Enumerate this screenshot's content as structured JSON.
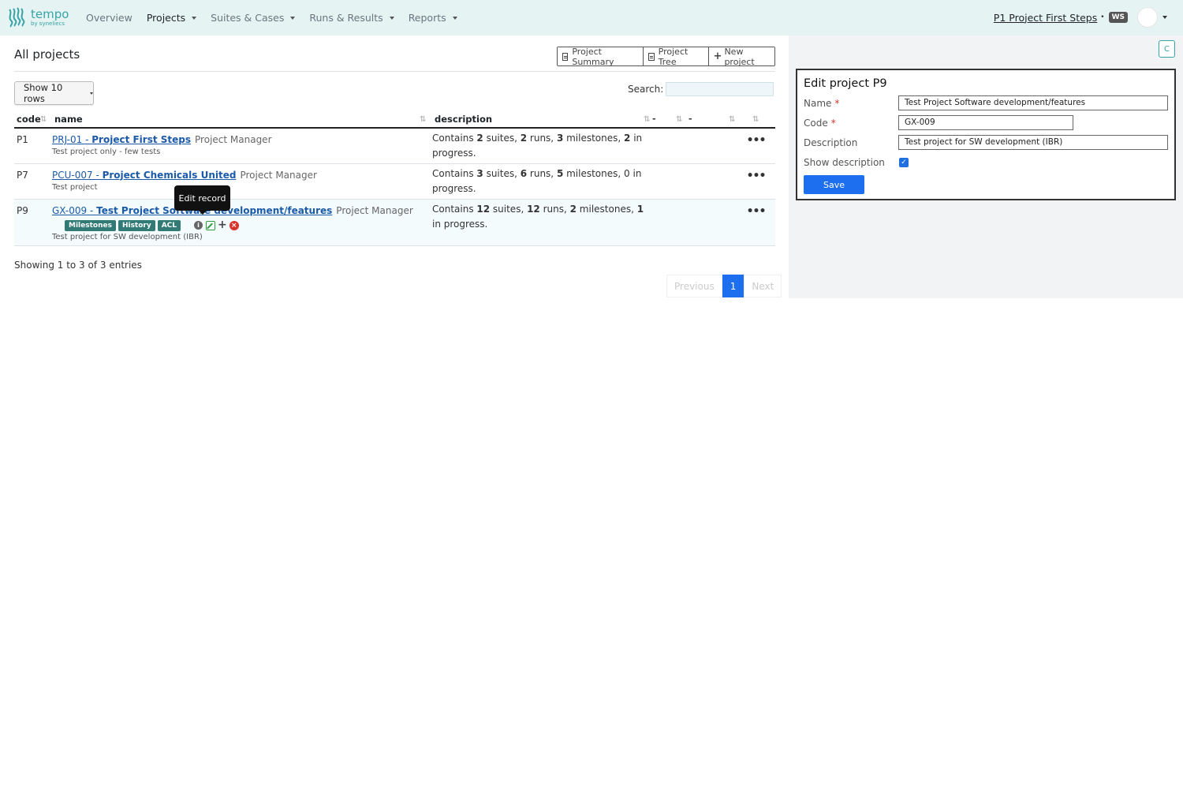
{
  "app": {
    "logo_word": "tempo",
    "logo_sub": "by syneliecs"
  },
  "nav": {
    "items": [
      {
        "label": "Overview",
        "has_caret": false
      },
      {
        "label": "Projects",
        "has_caret": true
      },
      {
        "label": "Suites & Cases",
        "has_caret": true
      },
      {
        "label": "Runs & Results",
        "has_caret": true
      },
      {
        "label": "Reports",
        "has_caret": true
      }
    ],
    "current_project": "P1 Project First Steps",
    "workspace_badge": "WS"
  },
  "page": {
    "title": "All projects",
    "buttons": {
      "project_summary": "Project Summary",
      "project_tree": "Project Tree",
      "new_project": "New project"
    },
    "rows_selector": "Show 10 rows",
    "search_label": "Search:",
    "search_value": ""
  },
  "table": {
    "headers": {
      "code": "code",
      "name": "name",
      "description": "description",
      "dash1": "-",
      "dash2": "-"
    },
    "rows": [
      {
        "code": "P1",
        "name_code": "PRJ-01 - ",
        "name_title": "Project First Steps",
        "role": "Project Manager",
        "subdesc": "Test project only - few tests",
        "d1": "Contains ",
        "n_suites": "2",
        "d2": " suites, ",
        "n_runs": "2",
        "d3": " runs, ",
        "n_milestones": "3",
        "d4": " milestones, ",
        "n_inprogress": "2",
        "d5": " in progress."
      },
      {
        "code": "P7",
        "name_code": "PCU-007 - ",
        "name_title": "Project Chemicals United",
        "role": "Project Manager",
        "subdesc": "Test project",
        "d1": "Contains ",
        "n_suites": "3",
        "d2": " suites, ",
        "n_runs": "6",
        "d3": " runs, ",
        "n_milestones": "5",
        "d4": " milestones, ",
        "n_inprogress": "0",
        "d5": " in progress."
      },
      {
        "code": "P9",
        "name_code": "GX-009 - ",
        "name_title": "Test Project Software development/features",
        "role": "Project Manager",
        "subdesc": "Test project for SW development (IBR)",
        "d1": "Contains ",
        "n_suites": "12",
        "d2": " suites, ",
        "n_runs": "12",
        "d3": " runs, ",
        "n_milestones": "2",
        "d4": " milestones, ",
        "n_inprogress": "1",
        "d5": " in progress.",
        "tags": [
          "Milestones",
          "History",
          "ACL"
        ]
      }
    ],
    "row_menu": "•••"
  },
  "tooltip": "Edit record",
  "footer": {
    "showing": "Showing 1 to 3 of 3 entries",
    "prev": "Previous",
    "page": "1",
    "next": "Next"
  },
  "sidebar": {
    "c_button": "C",
    "edit": {
      "title": "Edit project P9",
      "name_label": "Name",
      "name_value": "Test Project Software development/features",
      "code_label": "Code",
      "code_value": "GX-009",
      "desc_label": "Description",
      "desc_value": "Test project for SW development (IBR)",
      "show_desc_label": "Show description",
      "show_desc_checked": true,
      "save": "Save"
    }
  },
  "colors": {
    "topbar": "#e5f3f3",
    "brand": "#36a3a6",
    "link": "#1a5aa8",
    "primary": "#1e6ff0",
    "tag": "#317a75"
  }
}
